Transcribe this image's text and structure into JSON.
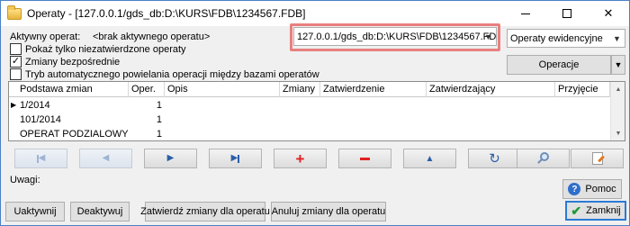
{
  "window": {
    "title": "Operaty - [127.0.0.1/gds_db:D:\\KURS\\FDB\\1234567.FDB]",
    "icon": "folder-icon"
  },
  "active_operat": {
    "label": "Aktywny operat:",
    "value": "<brak aktywnego operatu>"
  },
  "db_select": {
    "value": "127.0.0.1/gds_db:D:\\KURS\\FDB\\1234567.FDB",
    "highlight_color": "#e8807f"
  },
  "type_select": {
    "value": "Operaty ewidencyjne"
  },
  "operacje_button": {
    "label": "Operacje"
  },
  "checkboxes": [
    {
      "label": "Pokaż tylko niezatwierdzone operaty",
      "checked": false
    },
    {
      "label": "Zmiany bezpośrednie",
      "checked": true
    },
    {
      "label": "Tryb automatycznego powielania operacji między bazami operatów",
      "checked": false
    }
  ],
  "grid": {
    "columns": [
      "Podstawa zmian",
      "Oper.",
      "Opis",
      "Zmiany",
      "Zatwierdzenie",
      "Zatwierdzający",
      "Przyjęcie"
    ],
    "rows": [
      {
        "podstawa": "1/2014",
        "oper": "1",
        "current": true
      },
      {
        "podstawa": "101/2014",
        "oper": "1",
        "current": false
      },
      {
        "podstawa": "OPERAT PODZIALOWY",
        "oper": "1",
        "current": false
      }
    ]
  },
  "navigator": [
    {
      "icon": "first-icon",
      "enabled": false
    },
    {
      "icon": "prior-icon",
      "enabled": false
    },
    {
      "icon": "next-icon",
      "enabled": true
    },
    {
      "icon": "last-icon",
      "enabled": true
    },
    {
      "icon": "insert-icon",
      "enabled": true
    },
    {
      "icon": "delete-icon",
      "enabled": true
    },
    {
      "icon": "post-icon",
      "enabled": true
    },
    {
      "icon": "refresh-icon",
      "enabled": true
    },
    {
      "icon": "search-icon",
      "enabled": true
    },
    {
      "icon": "edit-icon",
      "enabled": true
    }
  ],
  "uwagi": {
    "label": "Uwagi:"
  },
  "buttons": {
    "help": "Pomoc",
    "activate": "Uaktywnij",
    "deactivate": "Deaktywuj",
    "approve": "Zatwierdź zmiany dla operatu",
    "cancel_changes": "Anuluj zmiany dla operatu",
    "close": "Zamknij"
  }
}
